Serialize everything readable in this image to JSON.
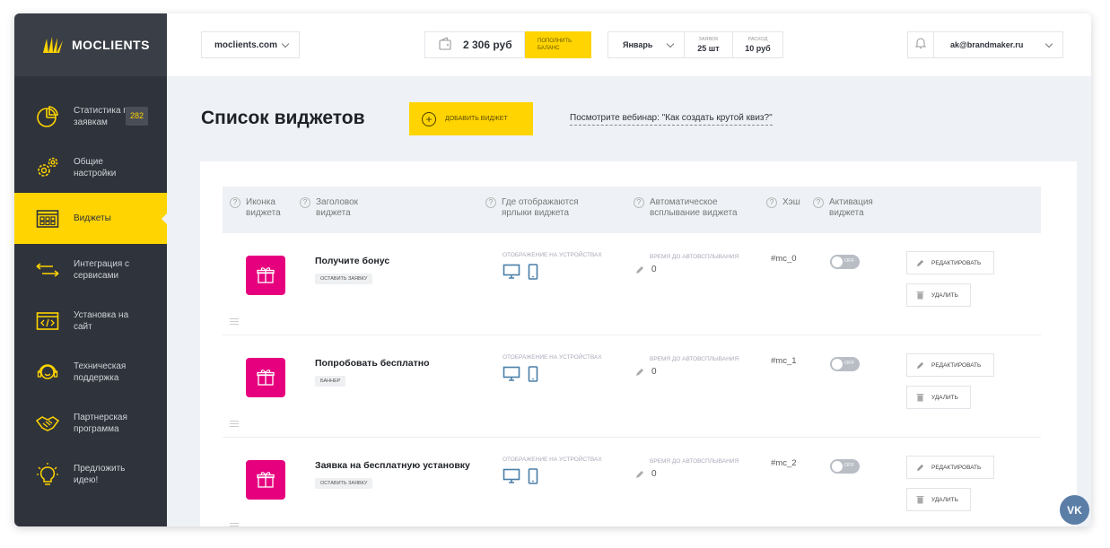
{
  "app": {
    "logo_text": "MOCLIENTS"
  },
  "sidebar": {
    "items": [
      {
        "label": "Статистика по заявкам",
        "icon": "pie-chart-icon",
        "badge": "282"
      },
      {
        "label": "Общие настройки",
        "icon": "gears-icon"
      },
      {
        "label": "Виджеты",
        "icon": "widgets-icon",
        "active": true
      },
      {
        "label": "Интеграция с сервисами",
        "icon": "arrows-exchange-icon"
      },
      {
        "label": "Установка на сайт",
        "icon": "code-window-icon"
      },
      {
        "label": "Техническая поддержка",
        "icon": "headset-icon"
      },
      {
        "label": "Партнерская программа",
        "icon": "handshake-icon"
      },
      {
        "label": "Предложить идею!",
        "icon": "lightbulb-icon"
      }
    ]
  },
  "topbar": {
    "site": "moclients.com",
    "balance": "2 306 руб",
    "topup_label": "Пополнить баланс",
    "month": "Январь",
    "requests_label": "Заявок",
    "requests_value": "25 шт",
    "expense_label": "Расход",
    "expense_value": "10 руб",
    "email": "ak@brandmaker.ru"
  },
  "header": {
    "title": "Список виджетов",
    "add_button": "Добавить виджет",
    "webinar_link": "Посмотрите вебинар: \"Как создать крутой квиз?\""
  },
  "table": {
    "columns": [
      "Иконка виджета",
      "Заголовок виджета",
      "Где отображаются ярлыки виджета",
      "Автоматическое всплывание виджета",
      "Хэш",
      "Активация виджета"
    ],
    "rows": [
      {
        "title": "Получите бонус",
        "tag": "Оставить заявку",
        "devices_label": "Отображение на устройствах",
        "auto_label": "Время до автовсплывания",
        "auto_value": "0",
        "hash": "#mc_0",
        "toggle": "OFF",
        "edit": "Редактировать",
        "delete": "Удалить"
      },
      {
        "title": "Попробовать бесплатно",
        "tag": "Баннер",
        "devices_label": "Отображение на устройствах",
        "auto_label": "Время до автовсплывания",
        "auto_value": "0",
        "hash": "#mc_1",
        "toggle": "OFF",
        "edit": "Редактировать",
        "delete": "Удалить"
      },
      {
        "title": "Заявка на бесплатную установку",
        "tag": "Оставить заявку",
        "devices_label": "Отображение на устройствах",
        "auto_label": "Время до автовсплывания",
        "auto_value": "0",
        "hash": "#mc_2",
        "toggle": "OFF",
        "edit": "Редактировать",
        "delete": "Удалить"
      }
    ]
  },
  "colors": {
    "accent": "#ffd400",
    "sidebar": "#2f333b",
    "widget_icon_bg": "#e6007e",
    "device_icon": "#4a7fa8"
  },
  "vk_label": "VK"
}
